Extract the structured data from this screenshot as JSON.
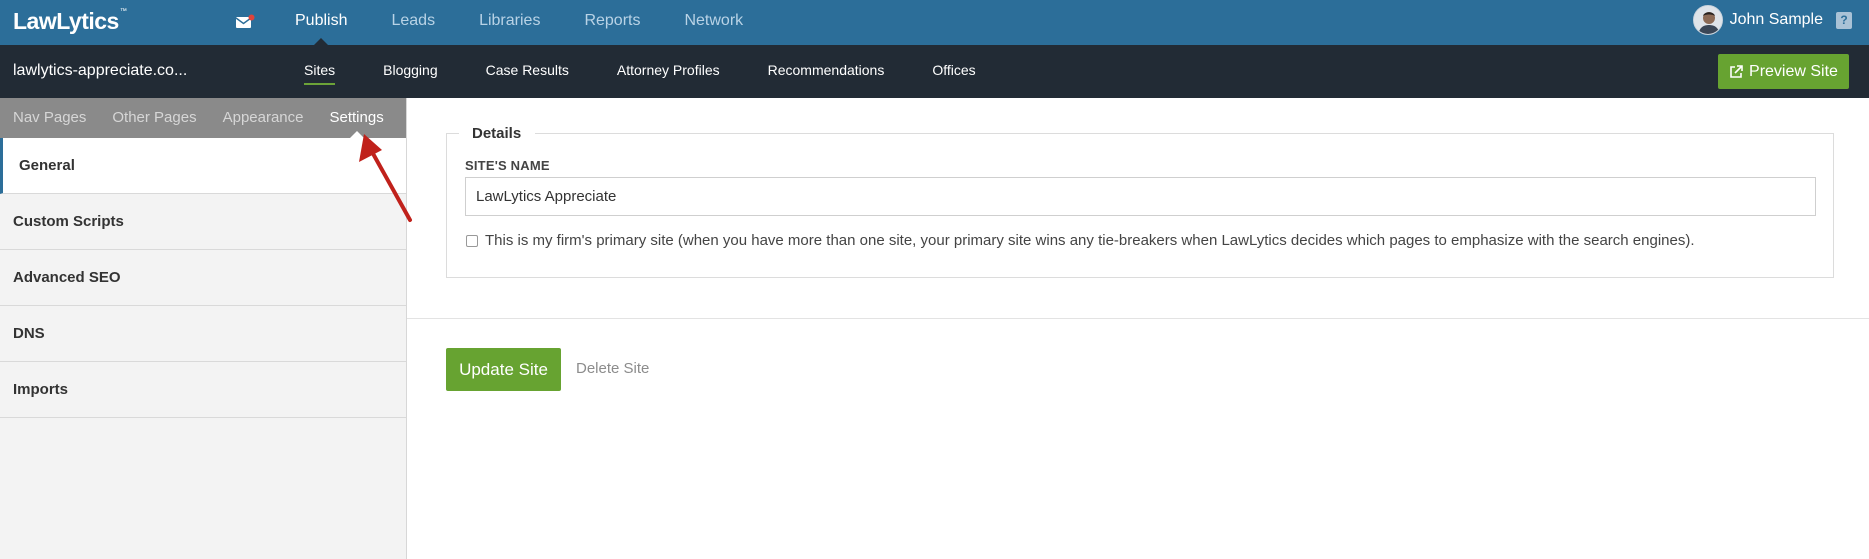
{
  "app": {
    "logo": "LawLytics",
    "logo_mark": "™"
  },
  "top_nav": {
    "items": [
      {
        "label": "Publish",
        "active": true
      },
      {
        "label": "Leads"
      },
      {
        "label": "Libraries"
      },
      {
        "label": "Reports"
      },
      {
        "label": "Network"
      }
    ]
  },
  "user": {
    "name": "John Sample"
  },
  "help": {
    "label": "?"
  },
  "site": {
    "domain": "lawlytics-appreciate.co..."
  },
  "sub_nav": {
    "items": [
      {
        "label": "Sites",
        "active": true
      },
      {
        "label": "Blogging"
      },
      {
        "label": "Case Results"
      },
      {
        "label": "Attorney Profiles"
      },
      {
        "label": "Recommendations"
      },
      {
        "label": "Offices"
      }
    ]
  },
  "preview_button": {
    "label": "Preview Site"
  },
  "sidebar": {
    "tabs": [
      {
        "label": "Nav Pages"
      },
      {
        "label": "Other Pages"
      },
      {
        "label": "Appearance"
      },
      {
        "label": "Settings",
        "active": true
      }
    ],
    "items": [
      {
        "label": "General",
        "active": true
      },
      {
        "label": "Custom Scripts"
      },
      {
        "label": "Advanced SEO"
      },
      {
        "label": "DNS"
      },
      {
        "label": "Imports"
      }
    ]
  },
  "details": {
    "legend": "Details",
    "site_name_label": "SITE'S NAME",
    "site_name_value": "LawLytics Appreciate",
    "primary_checkbox_checked": false,
    "primary_checkbox_label": "This is my firm's primary site (when you have more than one site, your primary site wins any tie-breakers when LawLytics decides which pages to emphasize with the search engines)."
  },
  "actions": {
    "update_label": "Update Site",
    "delete_label": "Delete Site"
  },
  "colors": {
    "topbar": "#2c6e99",
    "subbar": "#222b35",
    "accent_green": "#67a331",
    "annotation_arrow": "#c0211b"
  }
}
